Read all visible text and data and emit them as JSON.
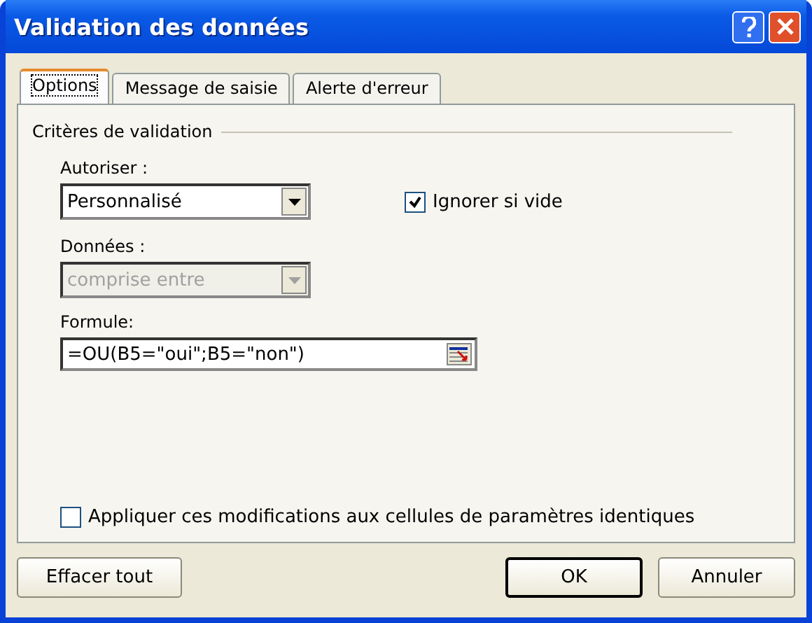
{
  "window": {
    "title": "Validation des données"
  },
  "tabs": [
    {
      "label": "Options",
      "selected": true
    },
    {
      "label": "Message de saisie",
      "selected": false
    },
    {
      "label": "Alerte d'erreur",
      "selected": false
    }
  ],
  "group": {
    "title": "Critères de validation"
  },
  "allow": {
    "label": "Autoriser :",
    "value": "Personnalisé",
    "disabled": false
  },
  "ignore_blank": {
    "label": "Ignorer si vide",
    "checked": true
  },
  "data": {
    "label": "Données :",
    "value": "comprise entre",
    "disabled": true
  },
  "formula": {
    "label": "Formule:",
    "value": "=OU(B5=\"oui\";B5=\"non\")"
  },
  "apply_all": {
    "label": "Appliquer ces modifications aux cellules de paramètres identiques",
    "checked": false
  },
  "buttons": [
    {
      "label": "Effacer tout",
      "kind": "left",
      "default": false
    },
    {
      "label": "OK",
      "kind": "right",
      "default": true
    },
    {
      "label": "Annuler",
      "kind": "right",
      "default": false
    }
  ]
}
